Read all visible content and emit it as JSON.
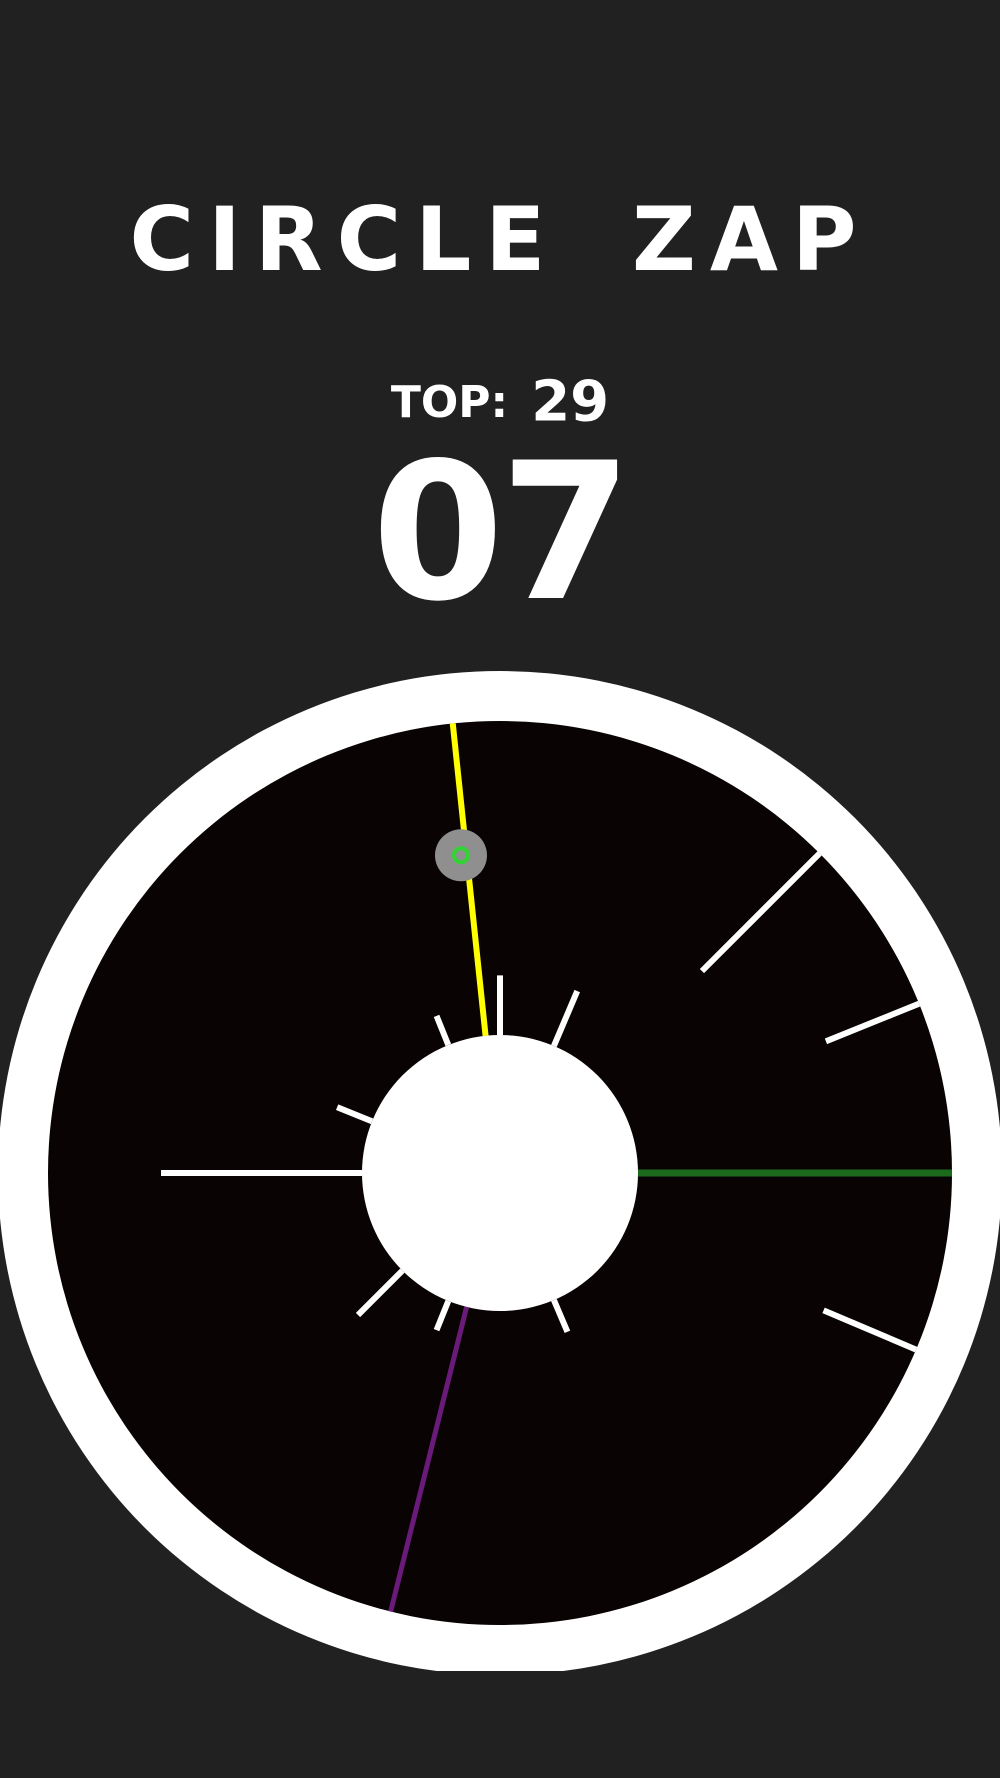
{
  "game": {
    "title": "CIRCLE ZAP",
    "top_label": "TOP:",
    "top_value": "29",
    "score": "07"
  },
  "colors": {
    "background": "#212121",
    "ring": "#ffffff",
    "arena": "#0a0303",
    "hub": "#ffffff",
    "obstacle": "#ffffff",
    "zapper": "#ffff00",
    "target_line": "#1c6b1c",
    "trail_line": "#6a1b7a",
    "player": "#8f8f8f",
    "player_core": "#34d334"
  },
  "board": {
    "obstacles": [
      {
        "angle": 0,
        "from": 0.0,
        "to": 0.19
      },
      {
        "angle": 23,
        "from": 0.0,
        "to": 0.19
      },
      {
        "angle": 45,
        "from": 0.47,
        "to": 1.0
      },
      {
        "angle": 68,
        "from": 0.68,
        "to": 1.0
      },
      {
        "angle": 113,
        "from": 0.68,
        "to": 1.0
      },
      {
        "angle": 157,
        "from": 0.0,
        "to": 0.11
      },
      {
        "angle": 202,
        "from": 0.0,
        "to": 0.1
      },
      {
        "angle": 225,
        "from": 0.0,
        "to": 0.2
      },
      {
        "angle": 270,
        "from": 0.0,
        "to": 0.64
      },
      {
        "angle": 292,
        "from": 0.0,
        "to": 0.12
      },
      {
        "angle": 338,
        "from": 0.0,
        "to": 0.1
      }
    ],
    "zapper_angle": 354,
    "target_angle": 90,
    "trail_angle": 194,
    "player_angle": 353,
    "player_position": 0.58
  }
}
